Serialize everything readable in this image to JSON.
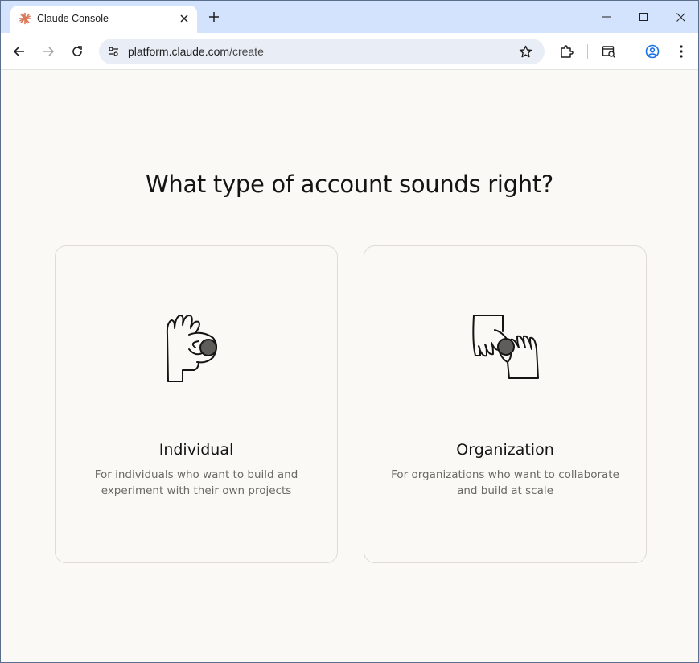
{
  "browser": {
    "tab": {
      "title": "Claude Console",
      "favicon": "claude-sunburst-icon",
      "favicon_color": "#d97757"
    },
    "address_bar": {
      "host": "platform.claude.com",
      "path": "/create"
    }
  },
  "page": {
    "heading": "What type of account sounds right?",
    "options": [
      {
        "title": "Individual",
        "description_line1": "For individuals who want to build and",
        "description_line2": "experiment with their own projects",
        "icon": "hand-holding-dot-icon"
      },
      {
        "title": "Organization",
        "description_line1": "For organizations who want to collaborate",
        "description_line2": "and build at scale",
        "icon": "two-hands-sharing-dot-icon"
      }
    ]
  },
  "colors": {
    "page_background": "#faf9f5",
    "tab_strip": "#d3e3fd",
    "card_border": "#dedcd4",
    "illustration_dot": "#5e5d59"
  }
}
